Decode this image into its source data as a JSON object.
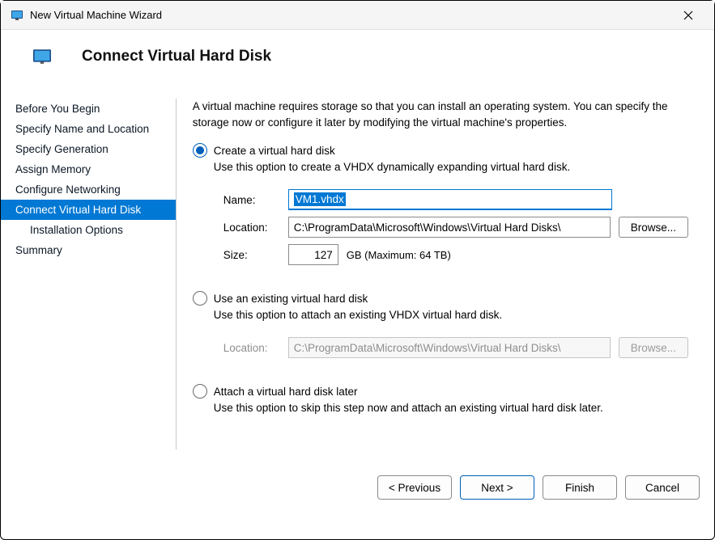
{
  "window": {
    "title": "New Virtual Machine Wizard"
  },
  "header": {
    "title": "Connect Virtual Hard Disk"
  },
  "nav": {
    "items": [
      {
        "label": "Before You Begin"
      },
      {
        "label": "Specify Name and Location"
      },
      {
        "label": "Specify Generation"
      },
      {
        "label": "Assign Memory"
      },
      {
        "label": "Configure Networking"
      },
      {
        "label": "Connect Virtual Hard Disk"
      },
      {
        "label": "Installation Options"
      },
      {
        "label": "Summary"
      }
    ]
  },
  "main": {
    "intro": "A virtual machine requires storage so that you can install an operating system. You can specify the storage now or configure it later by modifying the virtual machine's properties.",
    "opt_create": {
      "label": "Create a virtual hard disk",
      "desc": "Use this option to create a VHDX dynamically expanding virtual hard disk.",
      "name_label": "Name:",
      "name_value": "VM1.vhdx",
      "loc_label": "Location:",
      "loc_value": "C:\\ProgramData\\Microsoft\\Windows\\Virtual Hard Disks\\",
      "browse": "Browse...",
      "size_label": "Size:",
      "size_value": "127",
      "size_suffix": "GB (Maximum: 64 TB)"
    },
    "opt_existing": {
      "label": "Use an existing virtual hard disk",
      "desc": "Use this option to attach an existing VHDX virtual hard disk.",
      "loc_label": "Location:",
      "loc_value": "C:\\ProgramData\\Microsoft\\Windows\\Virtual Hard Disks\\",
      "browse": "Browse..."
    },
    "opt_later": {
      "label": "Attach a virtual hard disk later",
      "desc": "Use this option to skip this step now and attach an existing virtual hard disk later."
    }
  },
  "footer": {
    "previous": "< Previous",
    "next": "Next >",
    "finish": "Finish",
    "cancel": "Cancel"
  }
}
